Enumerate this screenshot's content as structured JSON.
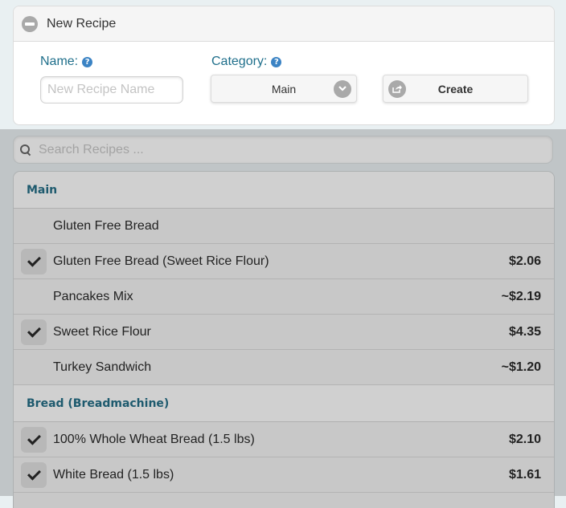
{
  "new_recipe_panel": {
    "title": "New Recipe",
    "collapse_icon": "minus-circle-icon",
    "name_label": "Name:",
    "name_placeholder": "New Recipe Name",
    "name_value": "",
    "category_label": "Category:",
    "help_glyph": "?",
    "category_selected": "Main",
    "create_label": "Create"
  },
  "search": {
    "placeholder": "Search Recipes ...",
    "value": ""
  },
  "groups": [
    {
      "name": "Main",
      "items": [
        {
          "label": "Gluten Free Bread",
          "checked": false,
          "price": ""
        },
        {
          "label": "Gluten Free Bread (Sweet Rice Flour)",
          "checked": true,
          "price": "$2.06"
        },
        {
          "label": "Pancakes Mix",
          "checked": false,
          "price": "~$2.19"
        },
        {
          "label": "Sweet Rice Flour",
          "checked": true,
          "price": "$4.35"
        },
        {
          "label": "Turkey Sandwich",
          "checked": false,
          "price": "~$1.20"
        }
      ]
    },
    {
      "name": "Bread (Breadmachine)",
      "items": [
        {
          "label": "100% Whole Wheat Bread (1.5 lbs)",
          "checked": true,
          "price": "$2.10"
        },
        {
          "label": "White Bread (1.5 lbs)",
          "checked": true,
          "price": "$1.61"
        }
      ]
    }
  ],
  "colors": {
    "label_accent": "#1f6f8b",
    "help_icon": "#3b83c4",
    "divider_text": "#1e5a6e"
  }
}
